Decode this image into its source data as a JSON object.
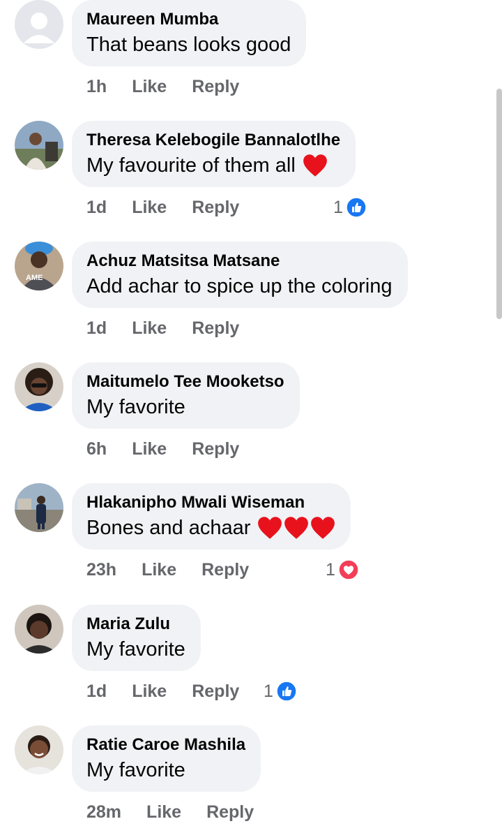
{
  "comments": [
    {
      "author": "Maureen Mumba",
      "text": "That beans looks good",
      "time": "1h",
      "like_label": "Like",
      "reply_label": "Reply",
      "avatar_icon": "default-profile-avatar"
    },
    {
      "author": "Theresa Kelebogile Bannalotlhe",
      "text": "My favourite of them all",
      "time": "1d",
      "like_label": "Like",
      "reply_label": "Reply",
      "reaction_count": "1",
      "reaction_icon": "like-reaction-icon",
      "heart_count": 1
    },
    {
      "author": "Achuz Matsitsa Matsane",
      "text": "Add achar to spice up the coloring",
      "time": "1d",
      "like_label": "Like",
      "reply_label": "Reply",
      "avatar_badge": "AME"
    },
    {
      "author": "Maitumelo Tee Mooketso",
      "text": "My favorite",
      "time": "6h",
      "like_label": "Like",
      "reply_label": "Reply"
    },
    {
      "author": "Hlakanipho Mwali Wiseman",
      "text": "Bones and achaar",
      "time": "23h",
      "like_label": "Like",
      "reply_label": "Reply",
      "reaction_count": "1",
      "reaction_icon": "love-reaction-icon",
      "heart_count": 3
    },
    {
      "author": "Maria Zulu",
      "text": "My favorite",
      "time": "1d",
      "like_label": "Like",
      "reply_label": "Reply",
      "reaction_count": "1",
      "reaction_icon": "like-reaction-icon"
    },
    {
      "author": "Ratie Caroe Mashila",
      "text": "My favorite",
      "time": "28m",
      "like_label": "Like",
      "reply_label": "Reply"
    }
  ],
  "colors": {
    "bubble_bg": "#f0f2f5",
    "action_text": "#65676b",
    "like_blue": "#1877f2",
    "love_red": "#f33e58",
    "heart_red": "#e8121c"
  }
}
